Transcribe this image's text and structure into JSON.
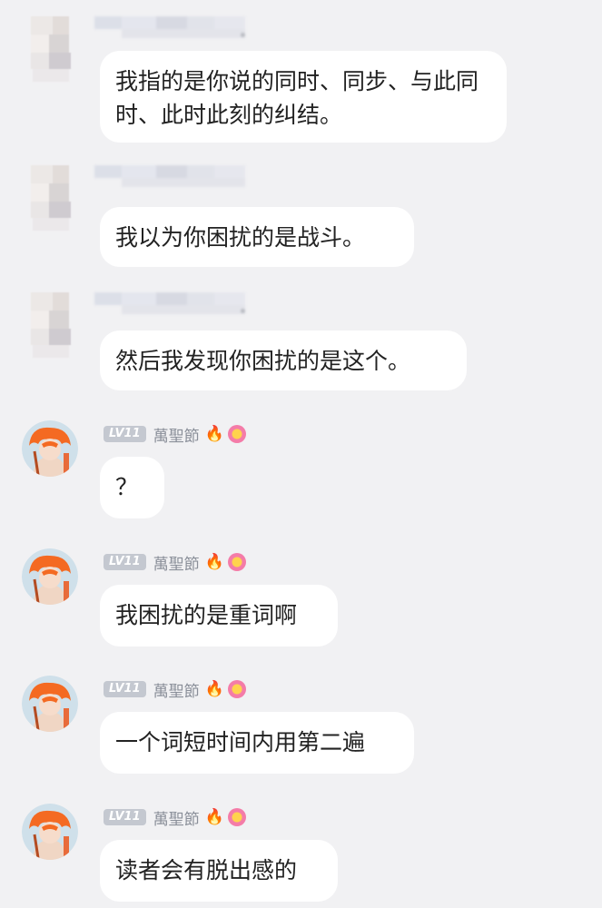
{
  "messages": [
    {
      "sender": "",
      "level": "",
      "text": "我指的是你说的同时、同步、与此同时、此时此刻的纠结。"
    },
    {
      "sender": "",
      "level": "",
      "text": "我以为你困扰的是战斗。"
    },
    {
      "sender": "",
      "level": "",
      "text": "然后我发现你困扰的是这个。"
    },
    {
      "sender": "萬聖節",
      "level": "LV11",
      "text": "？"
    },
    {
      "sender": "萬聖節",
      "level": "LV11",
      "text": "我困扰的是重词啊"
    },
    {
      "sender": "萬聖節",
      "level": "LV11",
      "text": "一个词短时间内用第二遍"
    },
    {
      "sender": "萬聖節",
      "level": "LV11",
      "text": "读者会有脱出感的"
    }
  ],
  "icons": {
    "fire": "fire-icon",
    "flower": "flower-emoji-icon"
  },
  "colors": {
    "background": "#f1f1f3",
    "bubble": "#ffffff",
    "level_badge": "#c4c8d0",
    "nickname": "#8a8f99"
  }
}
